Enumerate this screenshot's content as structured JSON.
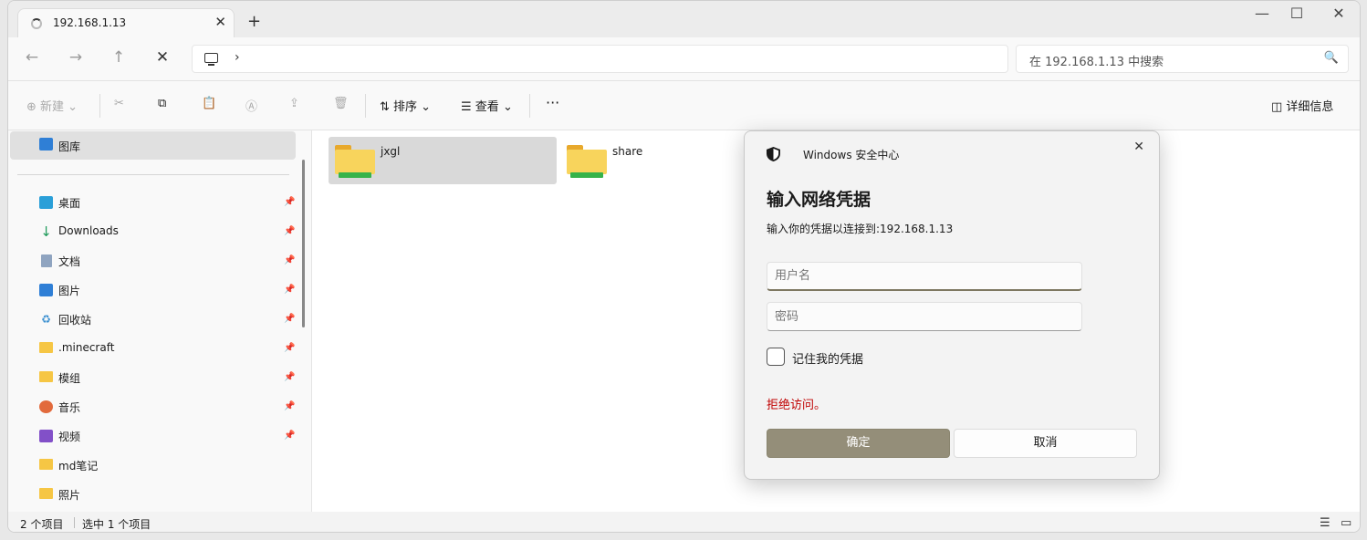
{
  "tab": {
    "title": "192.168.1.13",
    "close": "✕"
  },
  "newtab": "+",
  "window_controls": {
    "minimize": "—",
    "maximize": "☐",
    "close": "✕"
  },
  "nav": {
    "back": "←",
    "forward": "→",
    "up": "↑",
    "stop": "✕"
  },
  "address": {
    "chevron": "›"
  },
  "search": {
    "placeholder": "在 192.168.1.13 中搜索",
    "icon": "🔍"
  },
  "toolbar": {
    "new_label": "新建",
    "sort_label": "排序",
    "view_label": "查看",
    "more": "···",
    "details_label": "详细信息"
  },
  "sidebar": {
    "gallery": "图库",
    "items": [
      {
        "label": "桌面",
        "icon": "desktop-icon"
      },
      {
        "label": "Downloads",
        "icon": "download-icon"
      },
      {
        "label": "文档",
        "icon": "document-icon"
      },
      {
        "label": "图片",
        "icon": "pictures-icon"
      },
      {
        "label": "回收站",
        "icon": "recycle-bin-icon"
      },
      {
        "label": ".minecraft",
        "icon": "folder-icon"
      },
      {
        "label": "模组",
        "icon": "folder-icon"
      },
      {
        "label": "音乐",
        "icon": "music-icon"
      },
      {
        "label": "视频",
        "icon": "video-icon"
      },
      {
        "label": "md笔记",
        "icon": "folder-icon"
      },
      {
        "label": "照片",
        "icon": "folder-icon"
      }
    ]
  },
  "files": [
    {
      "name": "jxgl",
      "selected": true
    },
    {
      "name": "share",
      "selected": false
    }
  ],
  "status": {
    "count": "2 个项目",
    "selection": "选中 1 个项目"
  },
  "dialog": {
    "app_title": "Windows 安全中心",
    "close": "✕",
    "heading": "输入网络凭据",
    "subtitle": "输入你的凭据以连接到:192.168.1.13",
    "username_placeholder": "用户名",
    "password_placeholder": "密码",
    "remember_label": "记住我的凭据",
    "error": "拒绝访问。",
    "ok_label": "确定",
    "cancel_label": "取消"
  },
  "colors": {
    "accent": "#948e79",
    "error": "#c00000",
    "selection": "#d9d9d9"
  }
}
